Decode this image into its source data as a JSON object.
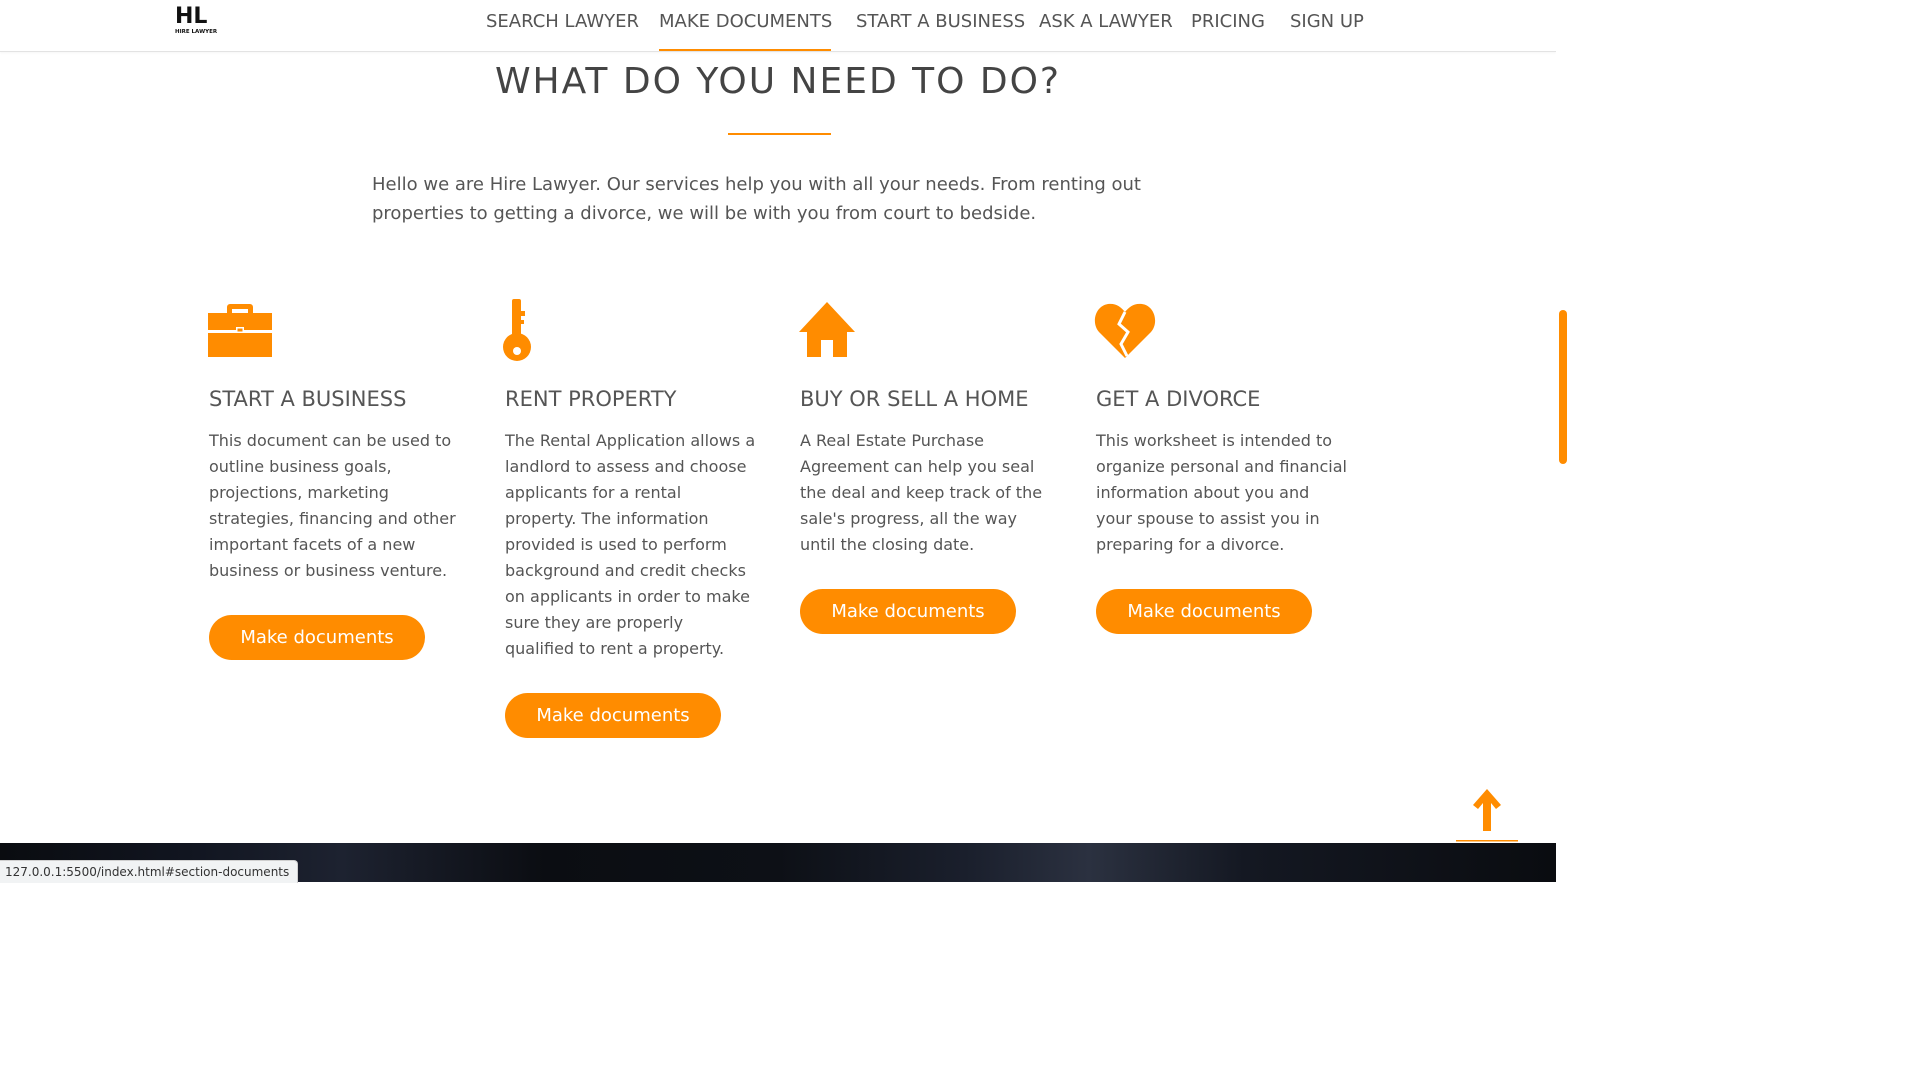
{
  "header": {
    "logo_main": "HL",
    "logo_sub": "HIRE LAWYER",
    "nav": [
      {
        "label": "SEARCH LAWYER",
        "active": false
      },
      {
        "label": "MAKE DOCUMENTS",
        "active": true
      },
      {
        "label": "START A BUSINESS",
        "active": false
      },
      {
        "label": "ASK A LAWYER",
        "active": false
      },
      {
        "label": "PRICING",
        "active": false
      },
      {
        "label": "SIGN UP",
        "active": false
      }
    ]
  },
  "section": {
    "title": "WHAT DO YOU NEED TO DO?",
    "intro": "Hello we are Hire Lawyer. Our services help you with all your needs. From renting out properties to getting a divorce, we will be with you from court to bedside."
  },
  "features": [
    {
      "icon": "briefcase-icon",
      "title": "START A BUSINESS",
      "text": "This document can be used to outline business goals, projections, marketing strategies, financing and other important facets of a new business or business venture.",
      "button": "Make documents"
    },
    {
      "icon": "key-icon",
      "title": "RENT PROPERTY",
      "text": "The Rental Application allows a landlord to assess and choose applicants for a rental property. The information provided is used to perform background and credit checks on applicants in order to make sure they are properly qualified to rent a property.",
      "button": "Make documents"
    },
    {
      "icon": "home-icon",
      "title": "BUY OR SELL A HOME",
      "text": "A Real Estate Purchase Agreement can help you seal the deal and keep track of the sale's progress, all the way until the closing date.",
      "button": "Make documents"
    },
    {
      "icon": "broken-heart-icon",
      "title": "GET A DIVORCE",
      "text": "This worksheet is intended to organize personal and financial information about you and your spouse to assist you in preparing for a divorce.",
      "button": "Make documents"
    }
  ],
  "status_bar": {
    "url": "127.0.0.1:5500/index.html#section-documents"
  },
  "colors": {
    "accent": "#ff8c00",
    "text": "#555555",
    "footer": "#0d1016"
  }
}
